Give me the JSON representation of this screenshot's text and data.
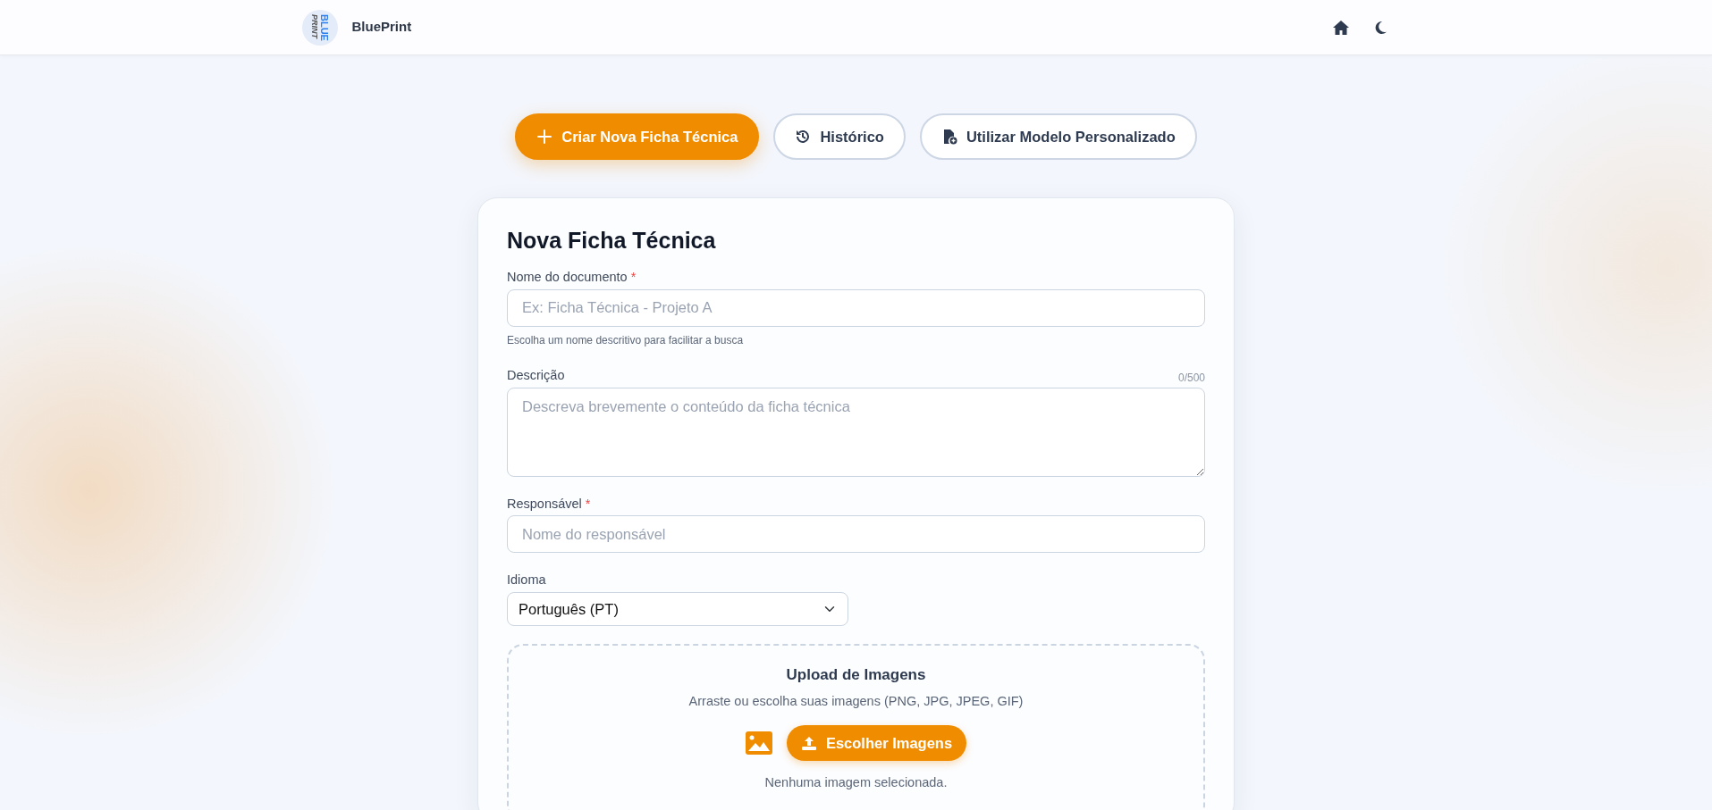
{
  "header": {
    "logo_text": [
      "BLUE",
      "PRINT"
    ],
    "brand": "BluePrint"
  },
  "tabs": [
    {
      "label": "Criar Nova Ficha Técnica",
      "selected": true
    },
    {
      "label": "Histórico",
      "selected": false
    },
    {
      "label": "Utilizar Modelo Personalizado",
      "selected": false
    }
  ],
  "form": {
    "title": "Nova Ficha Técnica",
    "fields": [
      {
        "kind": "input",
        "label": "Nome do documento",
        "required_mark": "*",
        "placeholder": "Ex: Ficha Técnica - Projeto A",
        "help": "Escolha um nome descritivo para facilitar a busca"
      },
      {
        "kind": "textarea",
        "label": "Descrição",
        "placeholder": "Descreva brevemente o conteúdo da ficha técnica",
        "counter": "0/500"
      },
      {
        "kind": "input",
        "label": "Responsável",
        "required_mark": "*",
        "placeholder": "Nome do responsável"
      },
      {
        "kind": "select",
        "label": "Idioma",
        "value": "Português (PT)"
      }
    ],
    "upload": {
      "title": "Upload de Imagens",
      "subtitle": "Arraste ou escolha suas imagens (PNG, JPG, JPEG, GIF)",
      "button": "Escolher Imagens",
      "status": "Nenhuma imagem selecionada."
    }
  }
}
